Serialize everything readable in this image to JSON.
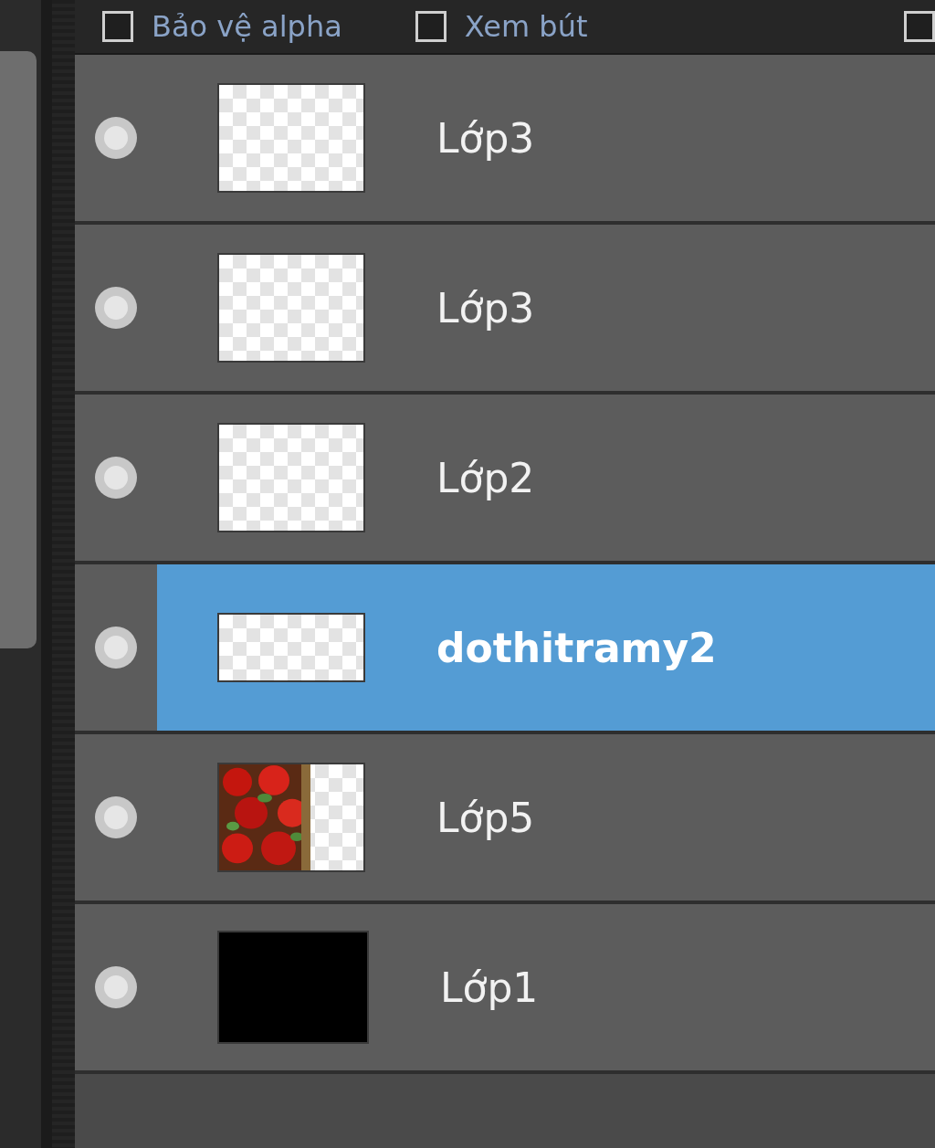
{
  "options": [
    {
      "label": "Bảo vệ alpha",
      "checked": false
    },
    {
      "label": "Xem bút",
      "checked": false
    },
    {
      "checked": false
    }
  ],
  "layers": [
    {
      "name": "Lớp3",
      "kind": "transparent",
      "selected": false
    },
    {
      "name": "Lớp3",
      "kind": "transparent",
      "selected": false
    },
    {
      "name": "Lớp2",
      "kind": "transparent",
      "selected": false
    },
    {
      "name": "dothitramy2",
      "kind": "wide",
      "selected": true
    },
    {
      "name": "Lớp5",
      "kind": "picture",
      "selected": false
    },
    {
      "name": "Lớp1",
      "kind": "black",
      "selected": false
    }
  ]
}
